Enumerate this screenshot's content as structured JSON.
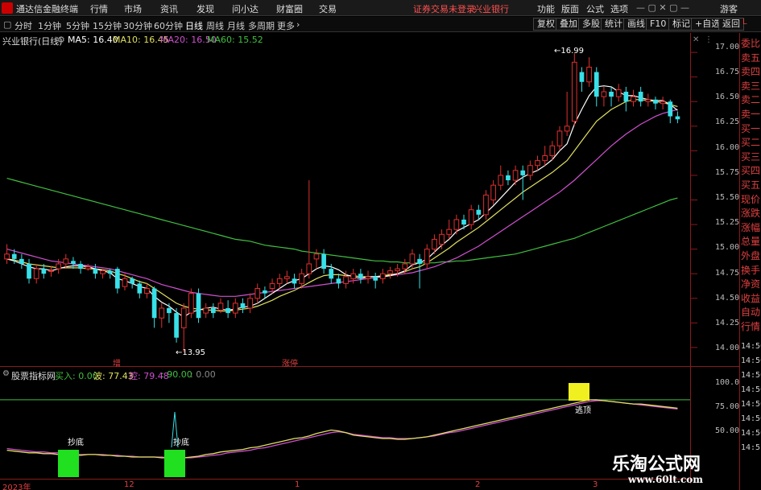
{
  "app": {
    "title": "通达信金融终端",
    "notice": "证券交易未登录",
    "broker": "兴业银行"
  },
  "menu": [
    "行情",
    "市场",
    "资讯",
    "发现",
    "问小达",
    "财富圈",
    "交易"
  ],
  "topright": [
    "功能",
    "版面",
    "公式",
    "选项"
  ],
  "guest": "游客",
  "toolbar": {
    "timeframes": [
      "分时",
      "1分钟",
      "5分钟",
      "15分钟",
      "30分钟",
      "60分钟",
      "日线",
      "周线",
      "月线",
      "多周期",
      "更多"
    ],
    "active": "日线",
    "buttons": [
      "复权",
      "叠加",
      "多股",
      "统计",
      "画线",
      "F10",
      "标记",
      "+自选",
      "返回"
    ]
  },
  "legend": {
    "stock": "兴业银行(日线)",
    "ma5": "MA5: 16.40",
    "ma10": "MA10: 16.45",
    "ma20": "MA20: 16.50",
    "ma60": "MA60: 15.52"
  },
  "colors": {
    "up": "#e03030",
    "down": "#38e0e8",
    "ma5": "#ffffff",
    "ma10": "#e0e060",
    "ma20": "#d050d0",
    "ma60": "#40c040"
  },
  "price_axis": [
    "17.00",
    "16.75",
    "16.50",
    "16.25",
    "16.00",
    "15.75",
    "15.50",
    "15.25",
    "15.00",
    "14.75",
    "14.50",
    "14.25",
    "14.00"
  ],
  "annotations": {
    "high": "16.99",
    "low": "13.95",
    "zeng": "增",
    "zhangting": "涨停"
  },
  "indicator": {
    "name": "股票指标网",
    "buy": "买入: 0.00",
    "wave": "波: 77.43",
    "control": "控: 79.48",
    "ninety": ": 90.00",
    "zero": ": 0.00",
    "axis": [
      "100.0",
      "75.00",
      "50.00"
    ],
    "labels": {
      "bottom1": "抄底",
      "bottom2": "抄底",
      "escape": "逃顶"
    }
  },
  "date_axis": [
    "2023年",
    "12",
    "1",
    "2",
    "3"
  ],
  "right_panel": [
    "委比",
    "卖五",
    "卖四",
    "卖三",
    "卖二",
    "卖一",
    "买一",
    "买二",
    "买三",
    "买四",
    "买五",
    "现价",
    "涨跌",
    "涨幅",
    "总量",
    "外盘",
    "换手",
    "净资",
    "收益",
    "自动",
    "行情"
  ],
  "right_times": [
    "14:50",
    "14:50",
    "14:50",
    "14:50",
    "14:50",
    "14:50",
    "14:50",
    "14:5"
  ],
  "watermark": {
    "line1": "乐淘公式网",
    "line2": "www.60lt.com"
  },
  "chart_data": {
    "type": "candlestick",
    "candles": [
      [
        14.9,
        14.95,
        15.05,
        14.85
      ],
      [
        14.95,
        14.9,
        15.0,
        14.85
      ],
      [
        14.9,
        14.85,
        14.95,
        14.8
      ],
      [
        14.85,
        14.7,
        14.9,
        14.65
      ],
      [
        14.7,
        14.8,
        14.85,
        14.65
      ],
      [
        14.8,
        14.75,
        14.85,
        14.7
      ],
      [
        14.78,
        14.78,
        14.83,
        14.72
      ],
      [
        14.8,
        14.85,
        14.9,
        14.75
      ],
      [
        14.85,
        14.9,
        14.95,
        14.8
      ],
      [
        14.88,
        14.85,
        14.92,
        14.8
      ],
      [
        14.85,
        14.8,
        14.88,
        14.75
      ],
      [
        14.8,
        14.82,
        14.85,
        14.78
      ],
      [
        14.8,
        14.75,
        14.85,
        14.7
      ],
      [
        14.75,
        14.78,
        14.8,
        14.7
      ],
      [
        14.78,
        14.75,
        14.8,
        14.7
      ],
      [
        14.8,
        14.6,
        14.82,
        14.55
      ],
      [
        14.62,
        14.7,
        14.75,
        14.58
      ],
      [
        14.7,
        14.65,
        14.72,
        14.6
      ],
      [
        14.65,
        14.55,
        14.68,
        14.5
      ],
      [
        14.55,
        14.6,
        14.65,
        14.5
      ],
      [
        14.6,
        14.3,
        14.62,
        14.2
      ],
      [
        14.3,
        14.4,
        14.45,
        14.2
      ],
      [
        14.4,
        14.35,
        14.45,
        14.25
      ],
      [
        14.35,
        14.1,
        14.4,
        14.05
      ],
      [
        14.2,
        14.4,
        14.45,
        13.95
      ],
      [
        14.35,
        14.55,
        14.6,
        14.3
      ],
      [
        14.55,
        14.3,
        14.6,
        14.25
      ],
      [
        14.35,
        14.4,
        14.45,
        14.3
      ],
      [
        14.4,
        14.35,
        14.45,
        14.3
      ],
      [
        14.38,
        14.45,
        14.5,
        14.35
      ],
      [
        14.4,
        14.35,
        14.48,
        14.3
      ],
      [
        14.35,
        14.45,
        14.5,
        14.3
      ],
      [
        14.45,
        14.4,
        14.5,
        14.35
      ],
      [
        14.4,
        14.5,
        14.55,
        14.35
      ],
      [
        14.5,
        14.6,
        14.65,
        14.45
      ],
      [
        14.58,
        14.55,
        14.62,
        14.5
      ],
      [
        14.6,
        14.65,
        14.7,
        14.55
      ],
      [
        14.65,
        14.7,
        14.75,
        14.6
      ],
      [
        14.7,
        14.72,
        14.78,
        14.65
      ],
      [
        14.7,
        14.65,
        14.75,
        14.6
      ],
      [
        14.65,
        14.75,
        14.8,
        14.6
      ],
      [
        14.75,
        14.85,
        15.7,
        14.7
      ],
      [
        14.9,
        14.95,
        15.0,
        14.8
      ],
      [
        14.95,
        14.8,
        15.0,
        14.75
      ],
      [
        14.8,
        14.7,
        14.85,
        14.65
      ],
      [
        14.7,
        14.65,
        14.75,
        14.6
      ],
      [
        14.65,
        14.72,
        14.78,
        14.6
      ],
      [
        14.7,
        14.75,
        14.8,
        14.65
      ],
      [
        14.75,
        14.7,
        14.8,
        14.65
      ],
      [
        14.7,
        14.72,
        14.78,
        14.65
      ],
      [
        14.72,
        14.68,
        14.76,
        14.6
      ],
      [
        14.7,
        14.75,
        14.8,
        14.65
      ],
      [
        14.75,
        14.78,
        14.82,
        14.7
      ],
      [
        14.78,
        14.8,
        14.85,
        14.72
      ],
      [
        14.8,
        14.85,
        14.9,
        14.75
      ],
      [
        14.85,
        14.95,
        15.0,
        14.8
      ],
      [
        14.9,
        14.85,
        14.95,
        14.6
      ],
      [
        14.85,
        15.0,
        15.05,
        14.8
      ],
      [
        15.0,
        15.1,
        15.15,
        14.95
      ],
      [
        15.05,
        15.15,
        15.2,
        15.0
      ],
      [
        15.15,
        15.2,
        15.3,
        15.1
      ],
      [
        15.2,
        15.3,
        15.35,
        15.15
      ],
      [
        15.3,
        15.25,
        15.35,
        15.2
      ],
      [
        15.25,
        15.4,
        15.45,
        15.2
      ],
      [
        15.4,
        15.35,
        15.45,
        15.3
      ],
      [
        15.35,
        15.55,
        15.6,
        15.3
      ],
      [
        15.5,
        15.65,
        15.7,
        15.45
      ],
      [
        15.65,
        15.75,
        15.85,
        15.6
      ],
      [
        15.75,
        15.7,
        15.8,
        15.65
      ],
      [
        15.7,
        15.8,
        15.85,
        15.65
      ],
      [
        15.8,
        15.75,
        15.85,
        15.5
      ],
      [
        15.75,
        15.85,
        15.9,
        15.7
      ],
      [
        15.85,
        15.9,
        15.95,
        15.8
      ],
      [
        15.9,
        15.95,
        16.05,
        15.85
      ],
      [
        15.95,
        16.05,
        16.1,
        15.9
      ],
      [
        16.05,
        16.2,
        16.25,
        16.0
      ],
      [
        16.2,
        16.25,
        16.6,
        16.15
      ],
      [
        16.3,
        16.9,
        16.99,
        16.25
      ],
      [
        16.8,
        16.7,
        16.85,
        16.6
      ],
      [
        16.7,
        16.85,
        16.95,
        16.65
      ],
      [
        16.8,
        16.55,
        16.85,
        16.45
      ],
      [
        16.55,
        16.6,
        16.65,
        16.45
      ],
      [
        16.6,
        16.55,
        16.65,
        16.45
      ],
      [
        16.55,
        16.62,
        16.68,
        16.5
      ],
      [
        16.6,
        16.5,
        16.65,
        16.4
      ],
      [
        16.5,
        16.55,
        16.62,
        16.45
      ],
      [
        16.6,
        16.5,
        16.65,
        16.45
      ],
      [
        16.5,
        16.52,
        16.58,
        16.45
      ],
      [
        16.52,
        16.48,
        16.55,
        16.42
      ],
      [
        16.48,
        16.5,
        16.55,
        16.42
      ],
      [
        16.5,
        16.35,
        16.52,
        16.28
      ],
      [
        16.35,
        16.32,
        16.4,
        16.28
      ]
    ],
    "ma5": [
      14.9,
      14.88,
      14.85,
      14.82,
      14.8,
      14.8,
      14.78,
      14.8,
      14.82,
      14.83,
      14.83,
      14.82,
      14.8,
      14.78,
      14.76,
      14.7,
      14.68,
      14.65,
      14.62,
      14.6,
      14.52,
      14.46,
      14.42,
      14.36,
      14.31,
      14.36,
      14.38,
      14.4,
      14.41,
      14.39,
      14.38,
      14.39,
      14.41,
      14.42,
      14.45,
      14.5,
      14.55,
      14.6,
      14.65,
      14.68,
      14.7,
      14.75,
      14.8,
      14.83,
      14.82,
      14.79,
      14.74,
      14.72,
      14.7,
      14.72,
      14.72,
      14.72,
      14.73,
      14.75,
      14.78,
      14.84,
      14.86,
      14.9,
      14.97,
      15.04,
      15.1,
      15.18,
      15.22,
      15.26,
      15.3,
      15.37,
      15.44,
      15.52,
      15.6,
      15.68,
      15.73,
      15.77,
      15.8,
      15.85,
      15.91,
      16.0,
      16.07,
      16.27,
      16.42,
      16.56,
      16.65,
      16.66,
      16.65,
      16.6,
      16.56,
      16.56,
      16.54,
      16.52,
      16.51,
      16.51,
      16.47,
      16.41
    ],
    "ma10": [
      14.9,
      14.89,
      14.87,
      14.85,
      14.84,
      14.83,
      14.82,
      14.81,
      14.81,
      14.81,
      14.81,
      14.8,
      14.8,
      14.79,
      14.78,
      14.75,
      14.73,
      14.7,
      14.67,
      14.65,
      14.6,
      14.55,
      14.5,
      14.45,
      14.42,
      14.4,
      14.39,
      14.38,
      14.38,
      14.37,
      14.37,
      14.38,
      14.39,
      14.4,
      14.42,
      14.45,
      14.48,
      14.52,
      14.55,
      14.58,
      14.62,
      14.66,
      14.7,
      14.73,
      14.74,
      14.74,
      14.73,
      14.73,
      14.72,
      14.72,
      14.72,
      14.73,
      14.74,
      14.75,
      14.77,
      14.8,
      14.82,
      14.86,
      14.91,
      14.96,
      15.01,
      15.07,
      15.12,
      15.17,
      15.22,
      15.28,
      15.34,
      15.4,
      15.46,
      15.52,
      15.58,
      15.63,
      15.68,
      15.73,
      15.78,
      15.84,
      15.9,
      16.0,
      16.1,
      16.2,
      16.3,
      16.36,
      16.42,
      16.46,
      16.5,
      16.52,
      16.52,
      16.51,
      16.5,
      16.49,
      16.47,
      16.45
    ],
    "ma20": [
      15.0,
      14.98,
      14.96,
      14.94,
      14.92,
      14.9,
      14.88,
      14.87,
      14.86,
      14.85,
      14.84,
      14.83,
      14.82,
      14.81,
      14.8,
      14.78,
      14.76,
      14.74,
      14.72,
      14.7,
      14.67,
      14.64,
      14.62,
      14.6,
      14.58,
      14.56,
      14.55,
      14.54,
      14.53,
      14.52,
      14.52,
      14.52,
      14.53,
      14.54,
      14.55,
      14.56,
      14.57,
      14.58,
      14.59,
      14.6,
      14.61,
      14.62,
      14.63,
      14.64,
      14.65,
      14.66,
      14.67,
      14.68,
      14.69,
      14.7,
      14.71,
      14.72,
      14.73,
      14.74,
      14.75,
      14.76,
      14.78,
      14.8,
      14.82,
      14.85,
      14.88,
      14.91,
      14.95,
      14.99,
      15.03,
      15.08,
      15.13,
      15.18,
      15.23,
      15.28,
      15.33,
      15.38,
      15.43,
      15.48,
      15.53,
      15.58,
      15.64,
      15.7,
      15.77,
      15.84,
      15.91,
      15.98,
      16.05,
      16.11,
      16.17,
      16.22,
      16.27,
      16.31,
      16.35,
      16.38,
      16.4,
      16.42
    ],
    "ma60": [
      15.72,
      15.7,
      15.68,
      15.66,
      15.64,
      15.62,
      15.6,
      15.58,
      15.56,
      15.54,
      15.52,
      15.5,
      15.48,
      15.46,
      15.44,
      15.42,
      15.4,
      15.38,
      15.36,
      15.34,
      15.32,
      15.3,
      15.28,
      15.26,
      15.24,
      15.22,
      15.2,
      15.18,
      15.16,
      15.14,
      15.12,
      15.1,
      15.09,
      15.08,
      15.06,
      15.04,
      15.03,
      15.02,
      15.01,
      15.0,
      14.98,
      14.97,
      14.96,
      14.95,
      14.94,
      14.93,
      14.92,
      14.91,
      14.9,
      14.89,
      14.88,
      14.88,
      14.87,
      14.87,
      14.86,
      14.86,
      14.86,
      14.86,
      14.86,
      14.87,
      14.87,
      14.88,
      14.88,
      14.89,
      14.9,
      14.91,
      14.92,
      14.93,
      14.94,
      14.95,
      14.97,
      14.99,
      15.01,
      15.03,
      15.05,
      15.07,
      15.09,
      15.11,
      15.14,
      15.17,
      15.2,
      15.23,
      15.26,
      15.29,
      15.32,
      15.35,
      15.38,
      15.41,
      15.44,
      15.47,
      15.5,
      15.52
    ],
    "ylim": [
      13.95,
      17.05
    ],
    "indicator_yellow": [
      30,
      29,
      28,
      27,
      27,
      26,
      26,
      25,
      25,
      24,
      24,
      25,
      25,
      24,
      24,
      23,
      23,
      22,
      22,
      22,
      22,
      21,
      21,
      21,
      21,
      22,
      23,
      25,
      26,
      28,
      29,
      30,
      31,
      33,
      34,
      36,
      38,
      40,
      42,
      44,
      45,
      47,
      50,
      52,
      54,
      53,
      51,
      48,
      47,
      46,
      45,
      44,
      44,
      43,
      43,
      44,
      45,
      46,
      48,
      50,
      52,
      54,
      56,
      58,
      60,
      62,
      64,
      66,
      68,
      70,
      72,
      74,
      76,
      78,
      80,
      82,
      84,
      86,
      88,
      90,
      90,
      89,
      88,
      87,
      86,
      85,
      85,
      84,
      83,
      82,
      81,
      80
    ],
    "indicator_magenta": [
      32,
      31,
      30,
      29,
      28,
      28,
      27,
      27,
      26,
      26,
      25,
      25,
      25,
      25,
      24,
      24,
      23,
      23,
      22,
      22,
      22,
      22,
      21,
      21,
      21,
      21,
      22,
      23,
      24,
      25,
      27,
      28,
      29,
      30,
      32,
      33,
      35,
      37,
      39,
      41,
      43,
      45,
      47,
      49,
      51,
      52,
      51,
      49,
      48,
      47,
      46,
      45,
      45,
      44,
      44,
      44,
      45,
      46,
      47,
      49,
      51,
      52,
      54,
      56,
      58,
      60,
      62,
      64,
      66,
      68,
      70,
      72,
      74,
      76,
      78,
      80,
      82,
      84,
      86,
      88,
      89,
      89,
      88,
      87,
      86,
      85,
      84,
      83,
      82,
      81,
      80,
      79
    ],
    "indicator_ylim": [
      0,
      110
    ]
  }
}
